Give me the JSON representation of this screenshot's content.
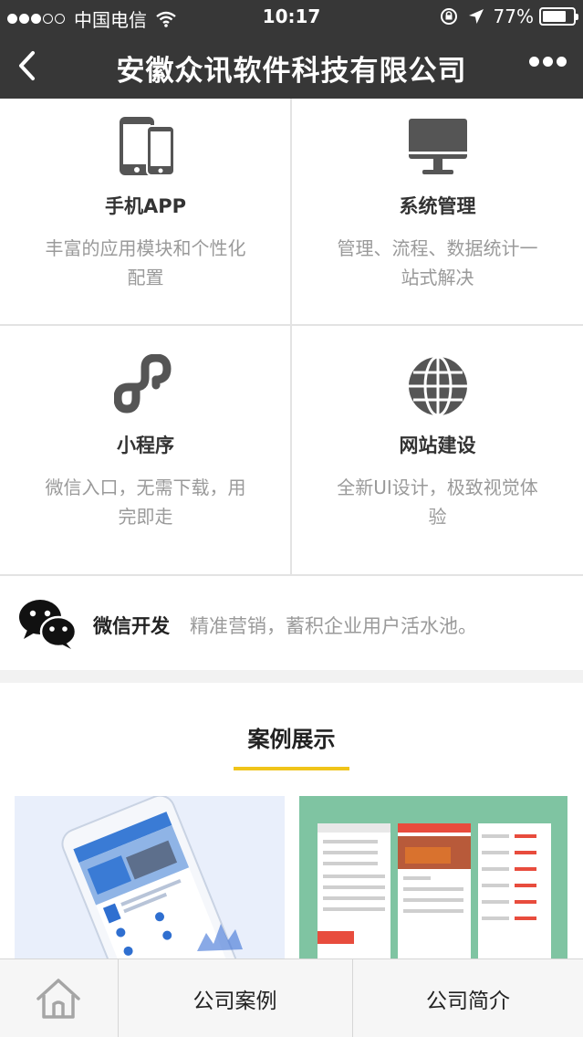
{
  "status_bar": {
    "carrier": "中国电信",
    "time": "10:17",
    "battery": "77%",
    "battery_level": 0.77
  },
  "nav": {
    "title": "安徽众讯软件科技有限公司"
  },
  "features": [
    {
      "icon": "phone-icon",
      "title": "手机APP",
      "desc": "丰富的应用模块和个性化配置"
    },
    {
      "icon": "monitor-icon",
      "title": "系统管理",
      "desc": "管理、流程、数据统计一站式解决"
    },
    {
      "icon": "mini-program-icon",
      "title": "小程序",
      "desc": "微信入口，无需下载，用完即走"
    },
    {
      "icon": "globe-icon",
      "title": "网站建设",
      "desc": "全新UI设计，极致视觉体验"
    }
  ],
  "wechat": {
    "title": "微信开发",
    "desc": "精准营销，蓄积企业用户活水池。"
  },
  "cases": {
    "title": "案例展示",
    "accent_color": "#f0c419"
  },
  "tabbar": {
    "home_icon": "home-icon",
    "cases_label": "公司案例",
    "about_label": "公司简介"
  },
  "colors": {
    "header_bg": "#373737",
    "muted_text": "#9a9a9a"
  }
}
